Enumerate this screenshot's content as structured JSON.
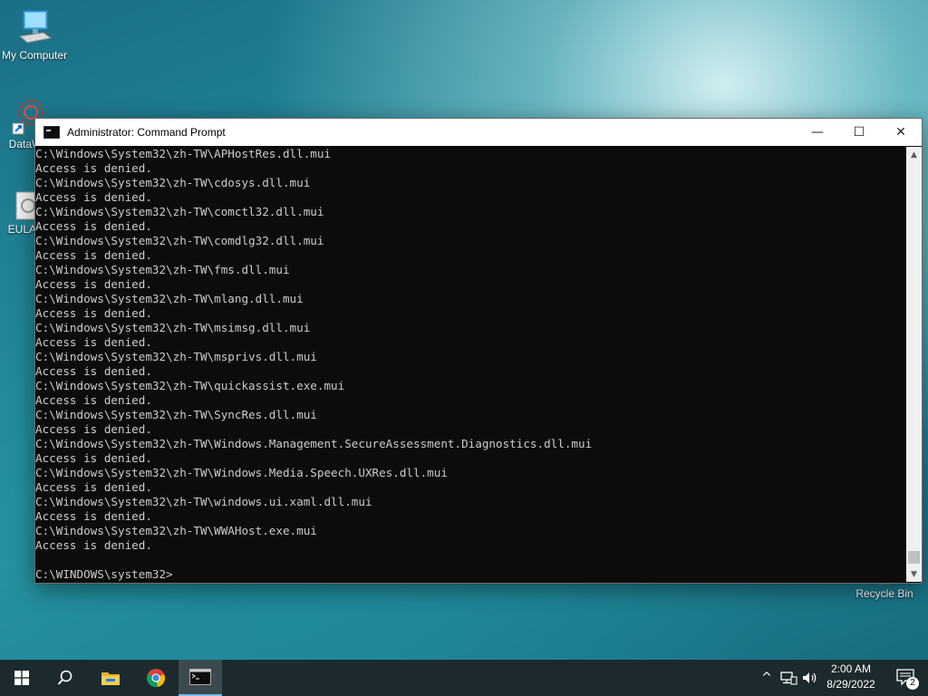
{
  "desktop": {
    "icons": [
      {
        "label": "My Computer",
        "icon": "computer-icon"
      },
      {
        "label": "DataW",
        "icon": "datawrapper-shortcut-icon"
      },
      {
        "label": "EULA.",
        "icon": "document-icon"
      },
      {
        "label": "Recycle Bin",
        "icon": "recycle-bin-icon"
      }
    ]
  },
  "window": {
    "title": "Administrator: Command Prompt",
    "buttons": {
      "minimize": "—",
      "maximize": "☐",
      "close": "✕"
    },
    "lines": [
      "C:\\Windows\\System32\\zh-TW\\APHostRes.dll.mui",
      "Access is denied.",
      "C:\\Windows\\System32\\zh-TW\\cdosys.dll.mui",
      "Access is denied.",
      "C:\\Windows\\System32\\zh-TW\\comctl32.dll.mui",
      "Access is denied.",
      "C:\\Windows\\System32\\zh-TW\\comdlg32.dll.mui",
      "Access is denied.",
      "C:\\Windows\\System32\\zh-TW\\fms.dll.mui",
      "Access is denied.",
      "C:\\Windows\\System32\\zh-TW\\mlang.dll.mui",
      "Access is denied.",
      "C:\\Windows\\System32\\zh-TW\\msimsg.dll.mui",
      "Access is denied.",
      "C:\\Windows\\System32\\zh-TW\\msprivs.dll.mui",
      "Access is denied.",
      "C:\\Windows\\System32\\zh-TW\\quickassist.exe.mui",
      "Access is denied.",
      "C:\\Windows\\System32\\zh-TW\\SyncRes.dll.mui",
      "Access is denied.",
      "C:\\Windows\\System32\\zh-TW\\Windows.Management.SecureAssessment.Diagnostics.dll.mui",
      "Access is denied.",
      "C:\\Windows\\System32\\zh-TW\\Windows.Media.Speech.UXRes.dll.mui",
      "Access is denied.",
      "C:\\Windows\\System32\\zh-TW\\windows.ui.xaml.dll.mui",
      "Access is denied.",
      "C:\\Windows\\System32\\zh-TW\\WWAHost.exe.mui",
      "Access is denied.",
      "",
      "C:\\WINDOWS\\system32>"
    ]
  },
  "taskbar": {
    "items": [
      {
        "name": "start-button",
        "icon": "windows-logo-icon"
      },
      {
        "name": "search-button",
        "icon": "search-icon"
      },
      {
        "name": "file-explorer-button",
        "icon": "folder-icon"
      },
      {
        "name": "chrome-button",
        "icon": "chrome-icon"
      },
      {
        "name": "command-prompt-button",
        "icon": "terminal-icon"
      }
    ],
    "tray": {
      "chevron": "^",
      "time": "2:00 AM",
      "date": "8/29/2022",
      "notification_count": "2"
    }
  },
  "colors": {
    "console_bg": "#0c0c0c",
    "console_text": "#cccccc",
    "taskbar": "#1c2a2e",
    "accent": "#76b9ed"
  }
}
